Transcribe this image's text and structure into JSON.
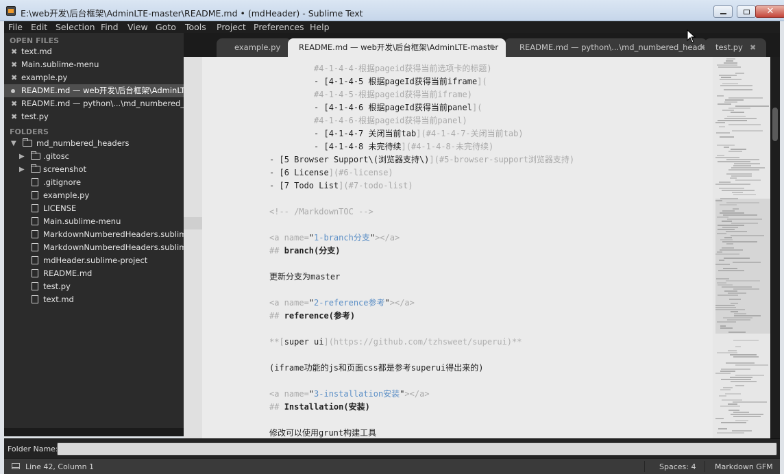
{
  "window": {
    "title": "E:\\web开发\\后台框架\\AdminLTE-master\\README.md • (mdHeader) - Sublime Text",
    "close_glyph": "✕"
  },
  "menu": [
    "File",
    "Edit",
    "Selection",
    "Find",
    "View",
    "Goto",
    "Tools",
    "Project",
    "Preferences",
    "Help"
  ],
  "sidebar": {
    "open_files_heading": "OPEN FILES",
    "open_files": [
      {
        "name": "text.md",
        "state": "close"
      },
      {
        "name": "Main.sublime-menu",
        "state": "close"
      },
      {
        "name": "example.py",
        "state": "close"
      },
      {
        "name": "README.md — web开发\\后台框架\\AdminLTE-master",
        "state": "dirty",
        "active": true
      },
      {
        "name": "README.md — python\\...\\md_numbered_headers",
        "state": "close"
      },
      {
        "name": "test.py",
        "state": "close"
      }
    ],
    "folders_heading": "FOLDERS",
    "tree": [
      {
        "name": "md_numbered_headers",
        "kind": "folder-open",
        "depth": 0
      },
      {
        "name": ".gitosc",
        "kind": "folder",
        "depth": 1
      },
      {
        "name": "screenshot",
        "kind": "folder",
        "depth": 1
      },
      {
        "name": ".gitignore",
        "kind": "file",
        "depth": 1
      },
      {
        "name": "example.py",
        "kind": "file",
        "depth": 1
      },
      {
        "name": "LICENSE",
        "kind": "file",
        "depth": 1
      },
      {
        "name": "Main.sublime-menu",
        "kind": "file",
        "depth": 1
      },
      {
        "name": "MarkdownNumberedHeaders.sublime-commands",
        "kind": "file",
        "depth": 1
      },
      {
        "name": "MarkdownNumberedHeaders.sublime-settings",
        "kind": "file",
        "depth": 1
      },
      {
        "name": "mdHeader.sublime-project",
        "kind": "file",
        "depth": 1
      },
      {
        "name": "README.md",
        "kind": "file",
        "depth": 1
      },
      {
        "name": "test.py",
        "kind": "file",
        "depth": 1
      },
      {
        "name": "text.md",
        "kind": "file",
        "depth": 1
      }
    ]
  },
  "tabs": [
    {
      "label": "example.py",
      "active": false,
      "state": "close"
    },
    {
      "label": "README.md — web开发\\后台框架\\AdminLTE-master",
      "active": true,
      "state": "dirty"
    },
    {
      "label": "README.md — python\\...\\md_numbered_headers",
      "active": false,
      "state": "close"
    },
    {
      "label": "test.py",
      "active": false,
      "state": "close"
    }
  ],
  "editor": {
    "lines": [
      [
        [
          "         ",
          ""
        ],
        [
          "#4-1-4-4-根据pageid获得当前选项卡的标题)",
          "com"
        ]
      ],
      [
        [
          "         - [",
          ""
        ],
        [
          "4-1-4-5 根据pageId获得当前iframe",
          ""
        ],
        [
          "](",
          "com"
        ]
      ],
      [
        [
          "         ",
          ""
        ],
        [
          "#4-1-4-5-根据pageid获得当前iframe)",
          "com"
        ]
      ],
      [
        [
          "         - [",
          ""
        ],
        [
          "4-1-4-6 根据pageId获得当前panel",
          ""
        ],
        [
          "](",
          "com"
        ]
      ],
      [
        [
          "         ",
          ""
        ],
        [
          "#4-1-4-6-根据pageid获得当前panel)",
          "com"
        ]
      ],
      [
        [
          "         - [",
          ""
        ],
        [
          "4-1-4-7 关闭当前tab",
          ""
        ],
        [
          "](#4-1-4-7-关闭当前tab)",
          "com"
        ]
      ],
      [
        [
          "         - [",
          ""
        ],
        [
          "4-1-4-8 未完待续",
          ""
        ],
        [
          "](#4-1-4-8-未完待续)",
          "com"
        ]
      ],
      [
        [
          "- [",
          ""
        ],
        [
          "5 Browser Support\\(浏览器支持\\)",
          ""
        ],
        [
          "](#5-browser-support浏览器支持)",
          "com"
        ]
      ],
      [
        [
          "- [",
          ""
        ],
        [
          "6 License",
          ""
        ],
        [
          "](#6-license)",
          "com"
        ]
      ],
      [
        [
          "- [",
          ""
        ],
        [
          "7 Todo List",
          ""
        ],
        [
          "](#7-todo-list)",
          "com"
        ]
      ],
      [
        [
          "",
          ""
        ]
      ],
      [
        [
          "<!-- /MarkdownTOC -->",
          "com"
        ]
      ],
      [
        [
          "",
          ""
        ]
      ],
      [
        [
          "<a name=",
          "com"
        ],
        [
          "\"",
          ""
        ],
        [
          "1-branch分支",
          "blue"
        ],
        [
          "\"",
          ""
        ],
        [
          "></a>",
          "com"
        ]
      ],
      [
        [
          "## ",
          "com"
        ],
        [
          "branch(分支)",
          "bold"
        ]
      ],
      [
        [
          "",
          ""
        ]
      ],
      [
        [
          "更新分支为master",
          ""
        ]
      ],
      [
        [
          "",
          ""
        ]
      ],
      [
        [
          "<a name=",
          "com"
        ],
        [
          "\"",
          ""
        ],
        [
          "2-reference参考",
          "blue"
        ],
        [
          "\"",
          ""
        ],
        [
          "></a>",
          "com"
        ]
      ],
      [
        [
          "## ",
          "com"
        ],
        [
          "reference(参考)",
          "bold"
        ]
      ],
      [
        [
          "",
          ""
        ]
      ],
      [
        [
          "**[",
          "com"
        ],
        [
          "super ui",
          ""
        ],
        [
          "](https://github.com/tzhsweet/superui)**",
          "url"
        ]
      ],
      [
        [
          "",
          ""
        ]
      ],
      [
        [
          "(iframe功能的js和页面css都是参考superui得出来的)",
          ""
        ]
      ],
      [
        [
          "",
          ""
        ]
      ],
      [
        [
          "<a name=",
          "com"
        ],
        [
          "\"",
          ""
        ],
        [
          "3-installation安装",
          "blue"
        ],
        [
          "\"",
          ""
        ],
        [
          "></a>",
          "com"
        ]
      ],
      [
        [
          "## ",
          "com"
        ],
        [
          "Installation(安装)",
          "bold"
        ]
      ],
      [
        [
          "",
          ""
        ]
      ],
      [
        [
          "修改可以使用grunt构建工具",
          ""
        ]
      ]
    ]
  },
  "panel": {
    "label": "Folder Name:",
    "value": ""
  },
  "status": {
    "position": "Line 42, Column 1",
    "indent": "Spaces: 4",
    "syntax": "Markdown GFM"
  },
  "colors": {
    "sidebar_bg": "#2b2b2b",
    "editor_bg": "#ebebeb",
    "link_blue": "#5c8fc6",
    "comment_gray": "#a9a9a9"
  }
}
